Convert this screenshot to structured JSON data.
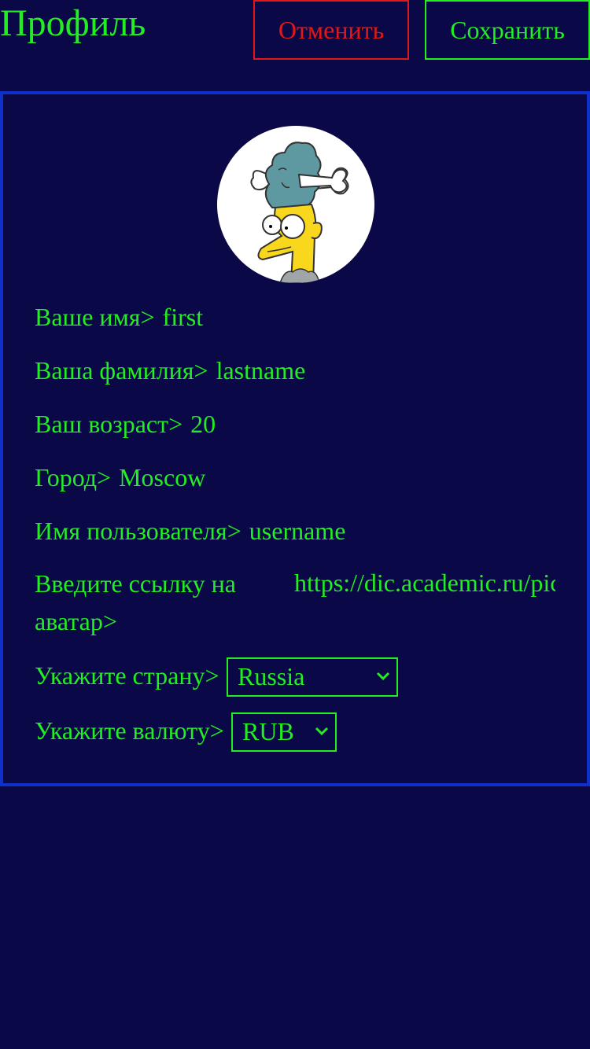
{
  "header": {
    "title": "Профиль",
    "cancel_label": "Отменить",
    "save_label": "Сохранить"
  },
  "colors": {
    "background": "#0a0846",
    "text": "#22ee22",
    "cancel": "#e01818",
    "panel_border": "#1030cc"
  },
  "profile": {
    "fields": [
      {
        "label": "Ваше имя>",
        "value": "first"
      },
      {
        "label": "Ваша фамилия>",
        "value": "lastname"
      },
      {
        "label": "Ваш возраст>",
        "value": "20"
      },
      {
        "label": "Город>",
        "value": "Moscow"
      },
      {
        "label": "Имя пользователя>",
        "value": "username"
      }
    ],
    "avatar_link": {
      "label": "Введите ссылку на аватар>",
      "value": "https://dic.academic.ru/pic"
    },
    "country": {
      "label": "Укажите страну>",
      "selected": "Russia"
    },
    "currency": {
      "label": "Укажите валюту>",
      "selected": "RUB"
    }
  }
}
